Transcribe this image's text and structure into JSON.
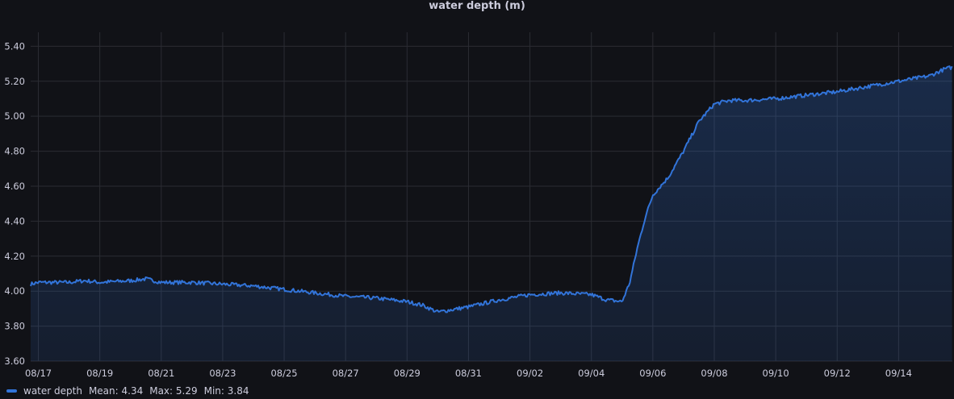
{
  "chart_data": {
    "type": "area",
    "title": "water depth (m)",
    "xlabel": "",
    "ylabel": "",
    "x_ticks": [
      "08/17",
      "08/19",
      "08/21",
      "08/23",
      "08/25",
      "08/27",
      "08/29",
      "08/31",
      "09/02",
      "09/04",
      "09/06",
      "09/08",
      "09/10",
      "09/12",
      "09/14"
    ],
    "y_ticks": [
      "3.60",
      "3.80",
      "4.00",
      "4.20",
      "4.40",
      "4.60",
      "4.80",
      "5.00",
      "5.20",
      "5.40"
    ],
    "ylim": [
      3.6,
      5.48
    ],
    "xlim": [
      "2023-08-16T18:00",
      "2023-09-15T18:00"
    ],
    "grid": true,
    "legend_position": "bottom-left",
    "series": [
      {
        "name": "water depth",
        "color": "#3274d9",
        "x": [
          "2023-08-16T18:00",
          "2023-08-17T00:00",
          "2023-08-18T00:00",
          "2023-08-18T12:00",
          "2023-08-19T00:00",
          "2023-08-20T00:00",
          "2023-08-20T12:00",
          "2023-08-21T00:00",
          "2023-08-22T00:00",
          "2023-08-23T00:00",
          "2023-08-24T00:00",
          "2023-08-25T00:00",
          "2023-08-26T00:00",
          "2023-08-27T00:00",
          "2023-08-28T00:00",
          "2023-08-29T00:00",
          "2023-08-29T12:00",
          "2023-08-30T00:00",
          "2023-08-31T00:00",
          "2023-09-01T00:00",
          "2023-09-02T00:00",
          "2023-09-03T00:00",
          "2023-09-04T00:00",
          "2023-09-04T12:00",
          "2023-09-05T00:00",
          "2023-09-05T06:00",
          "2023-09-05T12:00",
          "2023-09-05T18:00",
          "2023-09-06T00:00",
          "2023-09-06T12:00",
          "2023-09-07T00:00",
          "2023-09-07T12:00",
          "2023-09-08T00:00",
          "2023-09-08T12:00",
          "2023-09-09T00:00",
          "2023-09-10T00:00",
          "2023-09-11T00:00",
          "2023-09-12T00:00",
          "2023-09-13T00:00",
          "2023-09-14T00:00",
          "2023-09-15T00:00",
          "2023-09-15T12:00",
          "2023-09-15T18:00"
        ],
        "values": [
          4.04,
          4.05,
          4.05,
          4.06,
          4.05,
          4.06,
          4.07,
          4.05,
          4.05,
          4.04,
          4.03,
          4.01,
          3.99,
          3.97,
          3.96,
          3.94,
          3.92,
          3.88,
          3.91,
          3.95,
          3.98,
          3.99,
          3.98,
          3.95,
          3.94,
          4.05,
          4.25,
          4.42,
          4.55,
          4.65,
          4.8,
          4.97,
          5.07,
          5.09,
          5.09,
          5.1,
          5.12,
          5.14,
          5.17,
          5.2,
          5.23,
          5.27,
          5.28
        ]
      }
    ],
    "legend_stats": {
      "mean": "Mean: 4.34",
      "max": "Max: 5.29",
      "min": "Min: 3.84"
    }
  }
}
